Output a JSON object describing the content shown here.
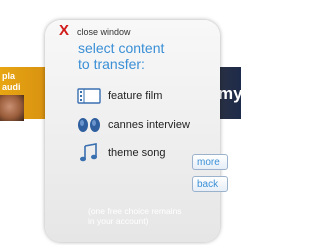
{
  "background": {
    "left_text_line1": "pla",
    "left_text_line2": "audi",
    "right_text": "my"
  },
  "dialog": {
    "close_glyph": "X",
    "close_label": "close window",
    "title_line1": "select content",
    "title_line2": "to transfer:",
    "items": [
      {
        "label": "feature film",
        "icon": "film-strip-icon"
      },
      {
        "label": "cannes interview",
        "icon": "interview-speakers-icon"
      },
      {
        "label": "theme song",
        "icon": "music-note-icon"
      }
    ],
    "note": "(one free choice remains in your account)"
  },
  "buttons": {
    "more": "more",
    "back": "back"
  },
  "colors": {
    "accent": "#3a8fd6",
    "close": "#d11a1a",
    "panel": "#efefef"
  }
}
